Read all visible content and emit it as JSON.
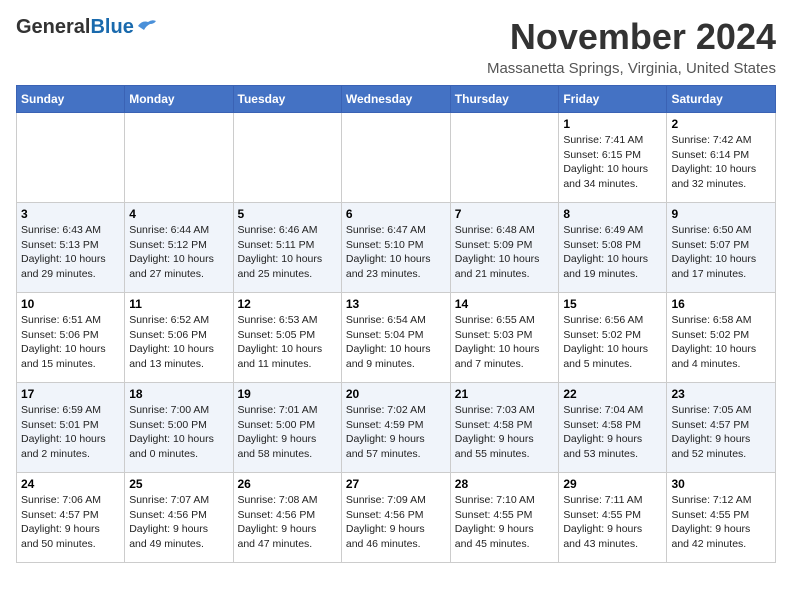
{
  "header": {
    "logo_general": "General",
    "logo_blue": "Blue",
    "month": "November 2024",
    "location": "Massanetta Springs, Virginia, United States"
  },
  "days_of_week": [
    "Sunday",
    "Monday",
    "Tuesday",
    "Wednesday",
    "Thursday",
    "Friday",
    "Saturday"
  ],
  "weeks": [
    [
      {
        "day": "",
        "info": ""
      },
      {
        "day": "",
        "info": ""
      },
      {
        "day": "",
        "info": ""
      },
      {
        "day": "",
        "info": ""
      },
      {
        "day": "",
        "info": ""
      },
      {
        "day": "1",
        "info": "Sunrise: 7:41 AM\nSunset: 6:15 PM\nDaylight: 10 hours\nand 34 minutes."
      },
      {
        "day": "2",
        "info": "Sunrise: 7:42 AM\nSunset: 6:14 PM\nDaylight: 10 hours\nand 32 minutes."
      }
    ],
    [
      {
        "day": "3",
        "info": "Sunrise: 6:43 AM\nSunset: 5:13 PM\nDaylight: 10 hours\nand 29 minutes."
      },
      {
        "day": "4",
        "info": "Sunrise: 6:44 AM\nSunset: 5:12 PM\nDaylight: 10 hours\nand 27 minutes."
      },
      {
        "day": "5",
        "info": "Sunrise: 6:46 AM\nSunset: 5:11 PM\nDaylight: 10 hours\nand 25 minutes."
      },
      {
        "day": "6",
        "info": "Sunrise: 6:47 AM\nSunset: 5:10 PM\nDaylight: 10 hours\nand 23 minutes."
      },
      {
        "day": "7",
        "info": "Sunrise: 6:48 AM\nSunset: 5:09 PM\nDaylight: 10 hours\nand 21 minutes."
      },
      {
        "day": "8",
        "info": "Sunrise: 6:49 AM\nSunset: 5:08 PM\nDaylight: 10 hours\nand 19 minutes."
      },
      {
        "day": "9",
        "info": "Sunrise: 6:50 AM\nSunset: 5:07 PM\nDaylight: 10 hours\nand 17 minutes."
      }
    ],
    [
      {
        "day": "10",
        "info": "Sunrise: 6:51 AM\nSunset: 5:06 PM\nDaylight: 10 hours\nand 15 minutes."
      },
      {
        "day": "11",
        "info": "Sunrise: 6:52 AM\nSunset: 5:06 PM\nDaylight: 10 hours\nand 13 minutes."
      },
      {
        "day": "12",
        "info": "Sunrise: 6:53 AM\nSunset: 5:05 PM\nDaylight: 10 hours\nand 11 minutes."
      },
      {
        "day": "13",
        "info": "Sunrise: 6:54 AM\nSunset: 5:04 PM\nDaylight: 10 hours\nand 9 minutes."
      },
      {
        "day": "14",
        "info": "Sunrise: 6:55 AM\nSunset: 5:03 PM\nDaylight: 10 hours\nand 7 minutes."
      },
      {
        "day": "15",
        "info": "Sunrise: 6:56 AM\nSunset: 5:02 PM\nDaylight: 10 hours\nand 5 minutes."
      },
      {
        "day": "16",
        "info": "Sunrise: 6:58 AM\nSunset: 5:02 PM\nDaylight: 10 hours\nand 4 minutes."
      }
    ],
    [
      {
        "day": "17",
        "info": "Sunrise: 6:59 AM\nSunset: 5:01 PM\nDaylight: 10 hours\nand 2 minutes."
      },
      {
        "day": "18",
        "info": "Sunrise: 7:00 AM\nSunset: 5:00 PM\nDaylight: 10 hours\nand 0 minutes."
      },
      {
        "day": "19",
        "info": "Sunrise: 7:01 AM\nSunset: 5:00 PM\nDaylight: 9 hours\nand 58 minutes."
      },
      {
        "day": "20",
        "info": "Sunrise: 7:02 AM\nSunset: 4:59 PM\nDaylight: 9 hours\nand 57 minutes."
      },
      {
        "day": "21",
        "info": "Sunrise: 7:03 AM\nSunset: 4:58 PM\nDaylight: 9 hours\nand 55 minutes."
      },
      {
        "day": "22",
        "info": "Sunrise: 7:04 AM\nSunset: 4:58 PM\nDaylight: 9 hours\nand 53 minutes."
      },
      {
        "day": "23",
        "info": "Sunrise: 7:05 AM\nSunset: 4:57 PM\nDaylight: 9 hours\nand 52 minutes."
      }
    ],
    [
      {
        "day": "24",
        "info": "Sunrise: 7:06 AM\nSunset: 4:57 PM\nDaylight: 9 hours\nand 50 minutes."
      },
      {
        "day": "25",
        "info": "Sunrise: 7:07 AM\nSunset: 4:56 PM\nDaylight: 9 hours\nand 49 minutes."
      },
      {
        "day": "26",
        "info": "Sunrise: 7:08 AM\nSunset: 4:56 PM\nDaylight: 9 hours\nand 47 minutes."
      },
      {
        "day": "27",
        "info": "Sunrise: 7:09 AM\nSunset: 4:56 PM\nDaylight: 9 hours\nand 46 minutes."
      },
      {
        "day": "28",
        "info": "Sunrise: 7:10 AM\nSunset: 4:55 PM\nDaylight: 9 hours\nand 45 minutes."
      },
      {
        "day": "29",
        "info": "Sunrise: 7:11 AM\nSunset: 4:55 PM\nDaylight: 9 hours\nand 43 minutes."
      },
      {
        "day": "30",
        "info": "Sunrise: 7:12 AM\nSunset: 4:55 PM\nDaylight: 9 hours\nand 42 minutes."
      }
    ]
  ]
}
